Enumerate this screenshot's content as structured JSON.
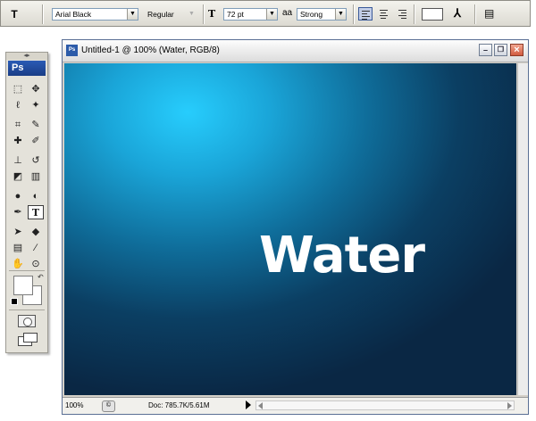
{
  "options_bar": {
    "tool_icon": "type-tool-options-icon",
    "font_family": "Arial Black",
    "font_style": "Regular",
    "font_size_icon": "font-size-icon",
    "font_size": "72 pt",
    "antialias_icon": "antialias-icon",
    "antialias_glyph": "aa",
    "antialias": "Strong",
    "align": [
      "left",
      "center",
      "right"
    ],
    "align_active": "left",
    "text_color": "#ffffff",
    "warp_icon": "warp-text-icon",
    "palettes_icon": "character-paragraph-palettes-icon"
  },
  "toolbox": {
    "logo": "Ps",
    "grip": "◂▸",
    "tools": [
      {
        "name": "marquee-tool",
        "glyph": "⬚"
      },
      {
        "name": "move-tool",
        "glyph": "✥"
      },
      {
        "name": "lasso-tool",
        "glyph": "ℓ"
      },
      {
        "name": "magic-wand-tool",
        "glyph": "✦"
      },
      {
        "name": "crop-tool",
        "glyph": "⌗"
      },
      {
        "name": "slice-tool",
        "glyph": "✎"
      },
      {
        "name": "healing-brush-tool",
        "glyph": "✚"
      },
      {
        "name": "brush-tool",
        "glyph": "✐"
      },
      {
        "name": "clone-stamp-tool",
        "glyph": "⊥"
      },
      {
        "name": "history-brush-tool",
        "glyph": "↺"
      },
      {
        "name": "eraser-tool",
        "glyph": "◩"
      },
      {
        "name": "gradient-tool",
        "glyph": "▥"
      },
      {
        "name": "blur-tool",
        "glyph": "●"
      },
      {
        "name": "dodge-tool",
        "glyph": "◐"
      },
      {
        "name": "pen-tool",
        "glyph": "✒"
      },
      {
        "name": "type-tool",
        "glyph": "T"
      },
      {
        "name": "path-selection-tool",
        "glyph": "➤"
      },
      {
        "name": "shape-tool",
        "glyph": "◆"
      },
      {
        "name": "notes-tool",
        "glyph": "▤"
      },
      {
        "name": "eyedropper-tool",
        "glyph": "∕"
      },
      {
        "name": "hand-tool",
        "glyph": "✋"
      },
      {
        "name": "zoom-tool",
        "glyph": "⊙"
      }
    ],
    "active_tool": "type-tool",
    "foreground_color": "#ffffff",
    "background_color": "#ffffff",
    "swap_glyph": "↶"
  },
  "document": {
    "app_icon": "Ps",
    "title": "Untitled-1 @ 100% (Water, RGB/8)",
    "canvas_text": "Water",
    "status": {
      "zoom": "100%",
      "doc_size": "Doc: 785.7K/5.61M"
    }
  }
}
